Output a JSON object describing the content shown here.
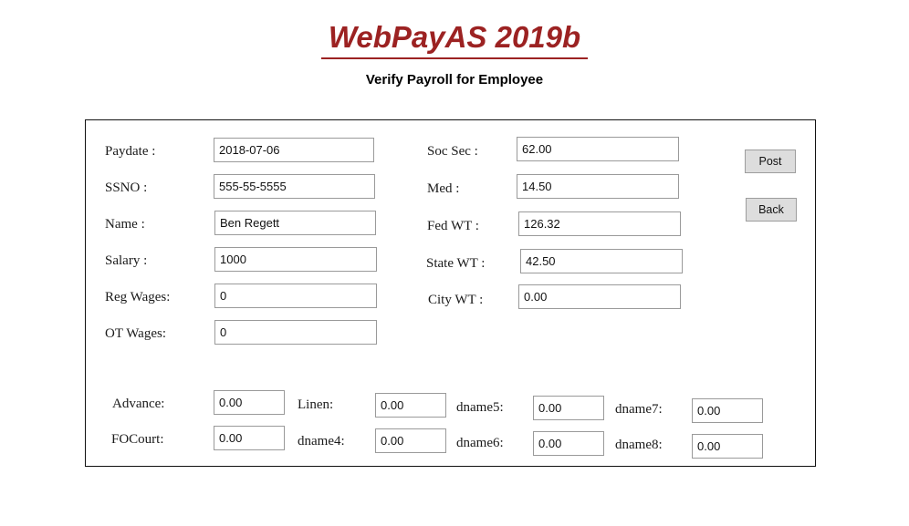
{
  "header": {
    "app_title": "WebPayAS 2019b",
    "subtitle": "Verify Payroll for Employee",
    "title_color": "#9c2222"
  },
  "form": {
    "left_column": [
      {
        "label": "Paydate :",
        "value": "2018-07-06",
        "name": "paydate"
      },
      {
        "label": "SSNO    :",
        "value": "555-55-5555",
        "name": "ssno"
      },
      {
        "label": "Name    :",
        "value": "Ben Regett",
        "name": "name"
      },
      {
        "label": "Salary   :",
        "value": "1000",
        "name": "salary"
      },
      {
        "label": "Reg Wages:",
        "value": "0",
        "name": "reg-wages"
      },
      {
        "label": "OT Wages:",
        "value": "0",
        "name": "ot-wages"
      }
    ],
    "right_column": [
      {
        "label": "Soc Sec  :",
        "value": "62.00",
        "name": "soc-sec"
      },
      {
        "label": "Med        :",
        "value": "14.50",
        "name": "med"
      },
      {
        "label": "Fed WT  :",
        "value": "126.32",
        "name": "fed-wt"
      },
      {
        "label": "State WT :",
        "value": "42.50",
        "name": "state-wt"
      },
      {
        "label": "City WT  :",
        "value": "0.00",
        "name": "city-wt"
      }
    ],
    "deductions": [
      {
        "label": "Advance:",
        "value": "0.00",
        "name": "advance"
      },
      {
        "label": "FOCourt:",
        "value": "0.00",
        "name": "focourt"
      },
      {
        "label": "Linen:",
        "value": "0.00",
        "name": "linen"
      },
      {
        "label": "dname4:",
        "value": "0.00",
        "name": "dname4"
      },
      {
        "label": "dname5:",
        "value": "0.00",
        "name": "dname5"
      },
      {
        "label": "dname6:",
        "value": "0.00",
        "name": "dname6"
      },
      {
        "label": "dname7:",
        "value": "0.00",
        "name": "dname7"
      },
      {
        "label": "dname8:",
        "value": "0.00",
        "name": "dname8"
      }
    ]
  },
  "actions": {
    "post_label": "Post",
    "back_label": "Back"
  }
}
